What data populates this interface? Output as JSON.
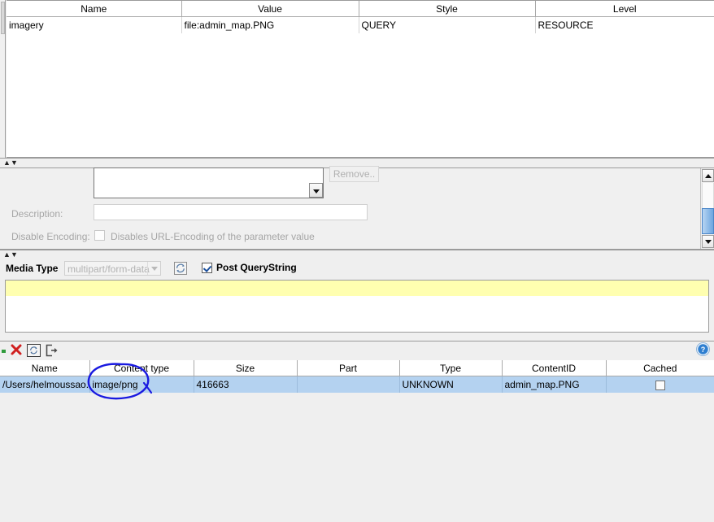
{
  "parameters_table": {
    "columns": [
      "Name",
      "Value",
      "Style",
      "Level"
    ],
    "rows": [
      {
        "name": "imagery",
        "value": "file:admin_map.PNG",
        "style": "QUERY",
        "level": "RESOURCE"
      }
    ]
  },
  "detail_panel": {
    "remove_button": "Remove..",
    "description_label": "Description:",
    "description_value": "",
    "disable_encoding_label": "Disable Encoding:",
    "disable_encoding_text": "Disables URL-Encoding of the parameter value",
    "disable_encoding_checked": false,
    "combo_value": ""
  },
  "media_type_row": {
    "label": "Media Type",
    "combo_value": "multipart/form-data",
    "refresh_icon": "refresh-icon",
    "post_querystring_label": "Post QueryString",
    "post_querystring_checked": true
  },
  "toolbar": {
    "delete_icon": "delete-x-icon",
    "reload_icon": "reload-icon",
    "export_icon": "export-icon",
    "help_icon": "help-question-icon",
    "status_dot_color": "#2f9b3c"
  },
  "attachments_table": {
    "columns": [
      "Name",
      "Content type",
      "Size",
      "Part",
      "Type",
      "ContentID",
      "Cached"
    ],
    "rows": [
      {
        "name": "/Users/helmoussao...",
        "content_type": "image/png",
        "size": "416663",
        "part": "",
        "type": "UNKNOWN",
        "content_id": "admin_map.PNG",
        "cached": false
      }
    ]
  },
  "annotation": {
    "shape": "hand-drawn-ellipse",
    "color": "#1a1ae0",
    "target": "image/png"
  },
  "colors": {
    "selection_blue": "#b4d2f0",
    "highlight_yellow": "#ffffb0",
    "panel_gray": "#efefef"
  }
}
